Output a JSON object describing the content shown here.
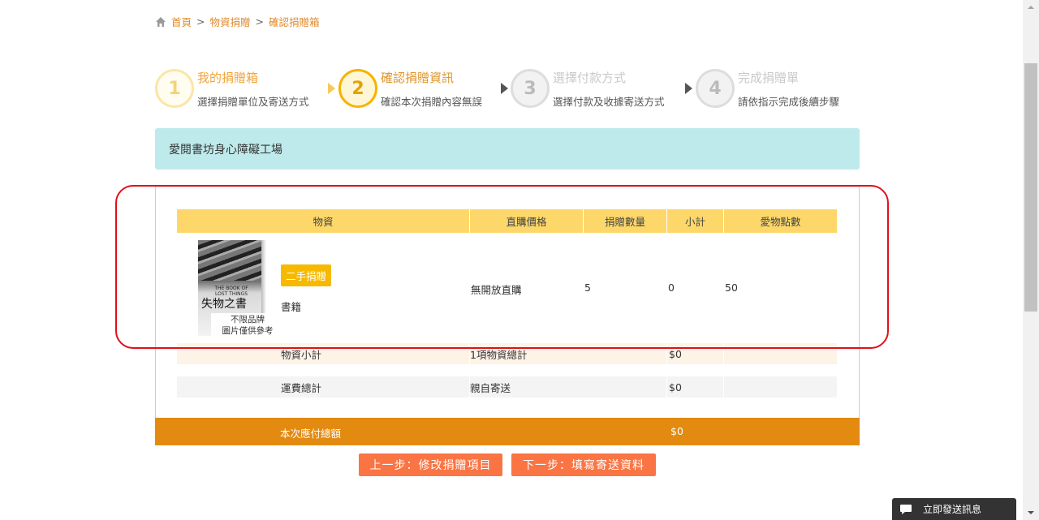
{
  "breadcrumb": {
    "home": "首頁",
    "sep1": ">",
    "level2": "物資捐贈",
    "sep2": ">",
    "current": "確認捐贈箱"
  },
  "steps": [
    {
      "num": "1",
      "title": "我的捐贈箱",
      "sub": "選擇捐贈單位及寄送方式"
    },
    {
      "num": "2",
      "title": "確認捐贈資訊",
      "sub": "確認本次捐贈內容無誤"
    },
    {
      "num": "3",
      "title": "選擇付款方式",
      "sub": "選擇付款及收據寄送方式"
    },
    {
      "num": "4",
      "title": "完成捐贈單",
      "sub": "請依指示完成後續步驟"
    }
  ],
  "org_name": "愛閱書坊身心障礙工場",
  "table": {
    "headers": [
      "物資",
      "直購價格",
      "捐贈數量",
      "小計",
      "愛物點數"
    ],
    "item": {
      "book_title_en": "THE BOOK OF LOST THINGS",
      "book_title_zh": "失物之書",
      "brand_note_1": "不限品牌",
      "brand_note_2": "圖片僅供參考",
      "badge": "二手捐贈",
      "category": "書籍",
      "price": "無開放直購",
      "qty": "5",
      "subtotal": "0",
      "points": "50"
    },
    "summary": [
      {
        "label": "物資小計",
        "desc": "1項物資總計",
        "amount": "$0"
      },
      {
        "label": "運費總計",
        "desc": "親自寄送",
        "amount": "$0"
      }
    ]
  },
  "total": {
    "label": "本次應付總額",
    "amount": "$0"
  },
  "buttons": {
    "prev": "上一步：修改捐贈項目",
    "next": "下一步：填寫寄送資料"
  },
  "chat": {
    "label": "立即發送訊息"
  },
  "colors": {
    "accent_orange": "#e38a11",
    "button": "#fb7443",
    "header_yellow": "#fdd76a",
    "org_bar": "#bfeaeb",
    "highlight_red": "#e0101a"
  }
}
